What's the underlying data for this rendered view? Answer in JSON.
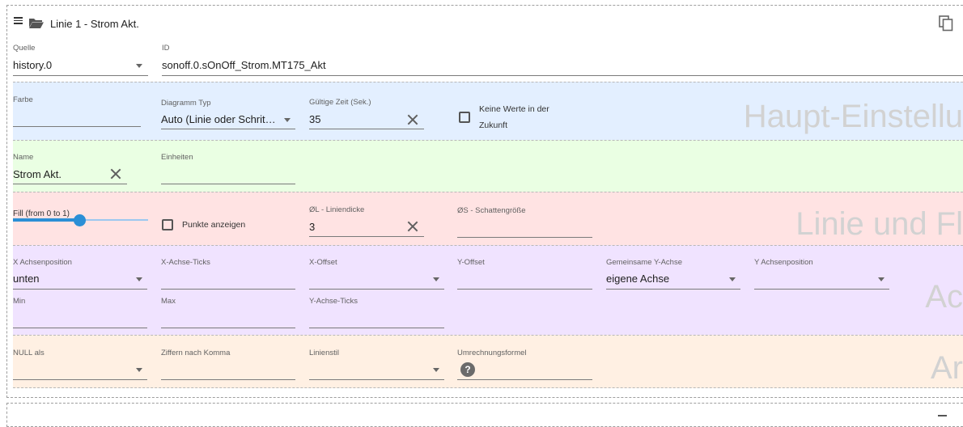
{
  "header": {
    "title": "Linie 1 - Strom Akt."
  },
  "source": {
    "quelle_label": "Quelle",
    "quelle_value": "history.0",
    "id_label": "ID",
    "id_value": "sonoff.0.sOnOff_Strom.MT175_Akt"
  },
  "main_settings": {
    "watermark": "Haupt-Einstellu",
    "farbe_label": "Farbe",
    "farbe_value": "",
    "diagramm_label": "Diagramm Typ",
    "diagramm_value": "Auto (Linie oder Schrit…",
    "gueltige_label": "Gültige Zeit (Sek.)",
    "gueltige_value": "35",
    "keine_werte_label_1": "Keine Werte in der",
    "keine_werte_label_2": "Zukunft",
    "keine_werte_checked": false
  },
  "name_section": {
    "name_label": "Name",
    "name_value": "Strom  Akt.",
    "einheiten_label": "Einheiten",
    "einheiten_value": ""
  },
  "line_section": {
    "watermark": "Linie und Fl",
    "fill_label": "Fill (from 0 to 1)",
    "fill_fraction": 0.5,
    "punkte_label": "Punkte anzeigen",
    "punkte_checked": false,
    "liniendicke_label": "ØL - Liniendicke",
    "liniendicke_value": "3",
    "schatten_label": "ØS - Schattengröße",
    "schatten_value": ""
  },
  "axis_section": {
    "watermark": "Ac",
    "x_pos_label": "X Achsenposition",
    "x_pos_value": "unten",
    "x_ticks_label": "X-Achse-Ticks",
    "x_offset_label": "X-Offset",
    "y_offset_label": "Y-Offset",
    "gemeinsame_label": "Gemeinsame Y-Achse",
    "gemeinsame_value": "eigene Achse",
    "y_pos_label": "Y Achsenposition",
    "y_pos_value": "",
    "min_label": "Min",
    "max_label": "Max",
    "y_ticks_label": "Y-Achse-Ticks"
  },
  "other_section": {
    "watermark": "Ar",
    "null_label": "NULL als",
    "ziffern_label": "Ziffern nach Komma",
    "linienstil_label": "Linienstil",
    "formel_label": "Umrechnungsformel",
    "formel_help": "?"
  },
  "icons": [
    "menu-icon",
    "folder-open-icon",
    "copy-icon",
    "clear-icon",
    "dropdown-arrow-icon",
    "help-icon"
  ]
}
